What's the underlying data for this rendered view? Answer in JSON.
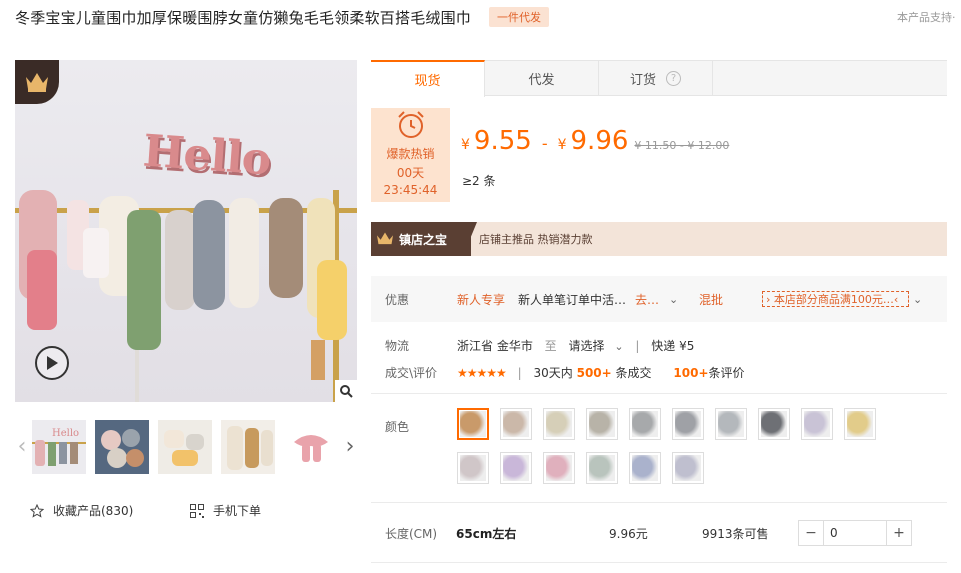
{
  "header": {
    "title": "冬季宝宝儿童围巾加厚保暖围脖女童仿獭兔毛毛领柔软百搭毛绒围巾",
    "tag": "一件代发",
    "support_text": "本产品支持·"
  },
  "gallery": {
    "main_image_text": "Hello",
    "prev_arrow": "‹",
    "next_arrow": "›"
  },
  "actions": {
    "collect_label": "收藏产品(830)",
    "mobile_order_label": "手机下单"
  },
  "tabs": [
    {
      "label": "现货",
      "active": true
    },
    {
      "label": "代发",
      "active": false
    },
    {
      "label": "订货",
      "active": false,
      "help": "?"
    }
  ],
  "flash_sale": {
    "label": "爆款热销",
    "days": "00天",
    "timer": "23:45:44"
  },
  "price": {
    "currency": "¥",
    "low": "9.55",
    "dash": "-",
    "high": "9.96",
    "original": "¥ 11.50 - ¥ 12.00",
    "min_qty": "≥2 条"
  },
  "shop_treasure": {
    "title": "镇店之宝",
    "info": "店铺主推品  热销潜力款"
  },
  "promo": {
    "label": "优惠",
    "new_customer": "新人专享",
    "desc": "新人单笔订单中活…",
    "go": "去…",
    "chevron": "⌄",
    "mix": "混批",
    "coupon": "› 本店部分商品满100元…‹"
  },
  "logistics": {
    "label": "物流",
    "origin": "浙江省 金华市",
    "to": "至",
    "select": "请选择",
    "express": "快递 ¥5"
  },
  "deals": {
    "label": "成交\\评价",
    "stars": "★★★★★",
    "days_prefix": "30天内",
    "count": "500+",
    "count_suffix": "条成交",
    "reviews": "100+",
    "reviews_suffix": "条评价"
  },
  "color": {
    "label": "颜色",
    "swatches": [
      {
        "color": "#c99a6a",
        "selected": true
      },
      {
        "color": "#cbb8a9"
      },
      {
        "color": "#d6cfb8"
      },
      {
        "color": "#b8b3a8"
      },
      {
        "color": "#a7a9ab"
      },
      {
        "color": "#9fa1a6"
      },
      {
        "color": "#b4b8bc"
      },
      {
        "color": "#6e7075"
      },
      {
        "color": "#c9c3d6"
      },
      {
        "color": "#e2cc8a"
      },
      {
        "color": "#d0c6c8"
      },
      {
        "color": "#c9b7d9"
      },
      {
        "color": "#e0b0bd"
      },
      {
        "color": "#b9c4bd"
      },
      {
        "color": "#aab2cc"
      },
      {
        "color": "#bfbfcf"
      }
    ]
  },
  "length": {
    "label": "长度(CM)",
    "value": "65cm左右",
    "price": "9.96元",
    "stock": "9913条可售",
    "qty": "0",
    "minus": "−",
    "plus": "+"
  }
}
